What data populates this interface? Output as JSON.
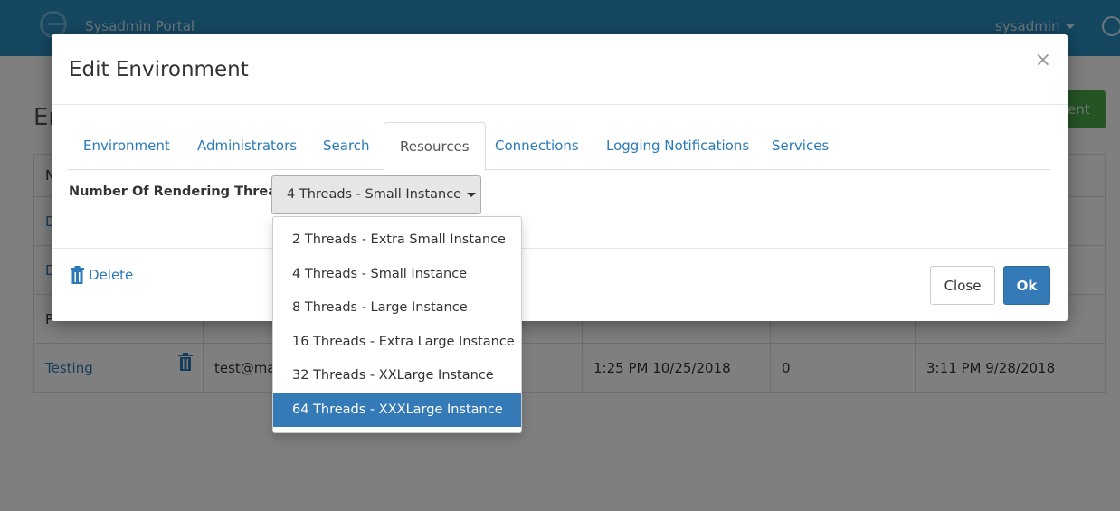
{
  "app": {
    "title": "Sysadmin Portal",
    "user": "sysadmin"
  },
  "background": {
    "heading": "En",
    "add_button": "ent",
    "table": {
      "header_first_cell": "N",
      "rows": [
        {
          "name": "D",
          "email": "",
          "created": "",
          "count": "",
          "updated": ""
        },
        {
          "name": "D",
          "email": "",
          "created": "",
          "count": "",
          "updated": ""
        },
        {
          "name": "P",
          "email": "",
          "created": "",
          "count": "",
          "updated": ""
        },
        {
          "name": "Testing",
          "email": "test@mai",
          "created": "1:25 PM 10/25/2018",
          "count": "0",
          "updated": "3:11 PM 9/28/2018"
        }
      ]
    }
  },
  "modal": {
    "title": "Edit Environment",
    "close_symbol": "×",
    "tabs": [
      {
        "label": "Environment"
      },
      {
        "label": "Administrators"
      },
      {
        "label": "Search"
      },
      {
        "label": "Resources",
        "active": true
      },
      {
        "label": "Connections"
      },
      {
        "label": "Logging Notifications"
      },
      {
        "label": "Services"
      }
    ],
    "field_label": "Number Of Rendering Threads",
    "selected_value": "4 Threads - Small Instance",
    "options": [
      "2 Threads - Extra Small Instance",
      "4 Threads - Small Instance",
      "8 Threads - Large Instance",
      "16 Threads - Extra Large Instance",
      "32 Threads - XXLarge Instance",
      "64 Threads - XXXLarge Instance"
    ],
    "highlighted_option_index": 5,
    "footer": {
      "delete_label": "Delete",
      "close_label": "Close",
      "ok_label": "Ok"
    }
  },
  "colors": {
    "topbar": "#2a8fc2",
    "link": "#2a7ab8",
    "primary": "#337ab7",
    "success": "#4aa84a"
  },
  "icons": [
    "logo-icon",
    "chevron-down-icon",
    "smiley-icon",
    "trash-icon",
    "close-icon",
    "caret-down-icon"
  ]
}
